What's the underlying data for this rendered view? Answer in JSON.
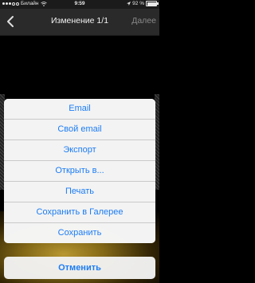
{
  "status_bar": {
    "carrier": "Билайн",
    "time": "9:59",
    "battery_percent": "92 %",
    "battery_level": 0.92,
    "icons": [
      "signal-icon",
      "wifi-icon",
      "location-icon",
      "battery-icon"
    ]
  },
  "nav": {
    "title": "Изменение 1/1",
    "next_label": "Далее",
    "back_icon": "chevron-left-icon"
  },
  "action_sheet": {
    "items": [
      {
        "label": "Email"
      },
      {
        "label": "Свой email"
      },
      {
        "label": "Экспорт"
      },
      {
        "label": "Открыть в..."
      },
      {
        "label": "Печать"
      },
      {
        "label": "Сохранить в Галерее"
      },
      {
        "label": "Сохранить"
      }
    ],
    "cancel_label": "Отменить"
  },
  "colors": {
    "accent": "#1b7cf4",
    "nav_background": "#2a2a2a",
    "sheet_background": "#f2f2f2"
  }
}
